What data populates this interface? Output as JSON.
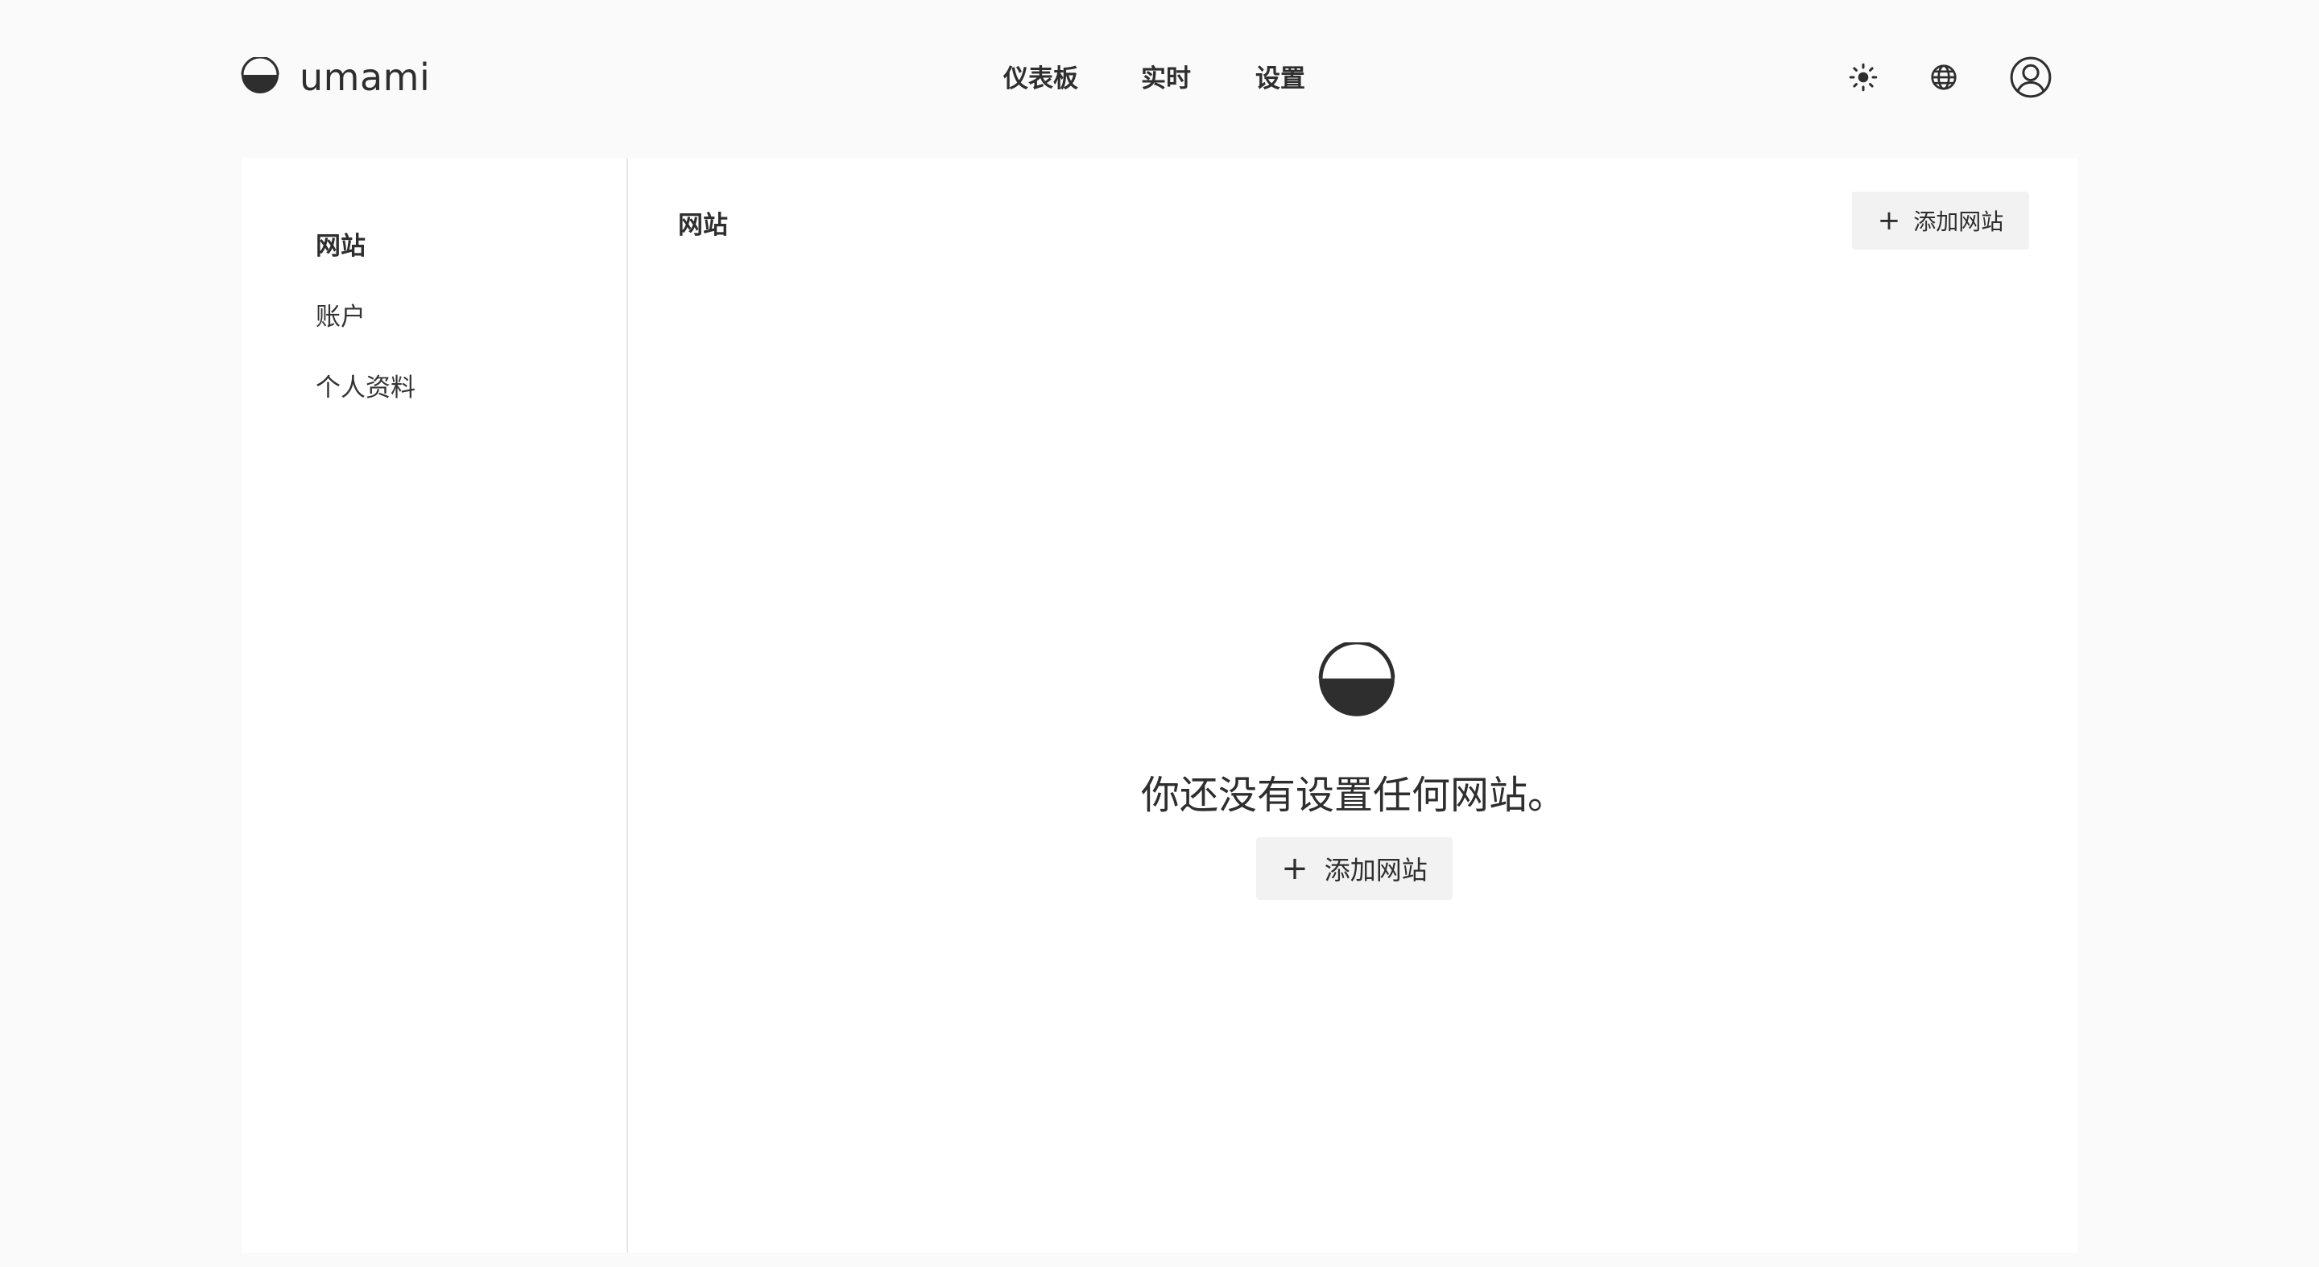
{
  "app": {
    "name": "umami"
  },
  "nav": {
    "items": [
      {
        "label": "仪表板"
      },
      {
        "label": "实时"
      },
      {
        "label": "设置"
      }
    ]
  },
  "header_buttons": {
    "theme_icon": "sun-icon",
    "language_icon": "globe-icon",
    "profile_icon": "user-circle-icon"
  },
  "sidebar": {
    "items": [
      {
        "label": "网站",
        "active": true
      },
      {
        "label": "账户",
        "active": false
      },
      {
        "label": "个人资料",
        "active": false
      }
    ]
  },
  "content": {
    "title": "网站",
    "add_button": {
      "icon": "+",
      "label": "添加网站"
    },
    "empty_state": {
      "icon": "umami-logo-icon",
      "message": "你还没有设置任何网站。",
      "button": {
        "icon": "+",
        "label": "添加网站"
      }
    }
  },
  "colors": {
    "page_background": "#fafafa",
    "card_background": "#ffffff",
    "text": "#2e2e2e",
    "button_background": "#f2f2f2",
    "divider": "#e6e6e6"
  }
}
